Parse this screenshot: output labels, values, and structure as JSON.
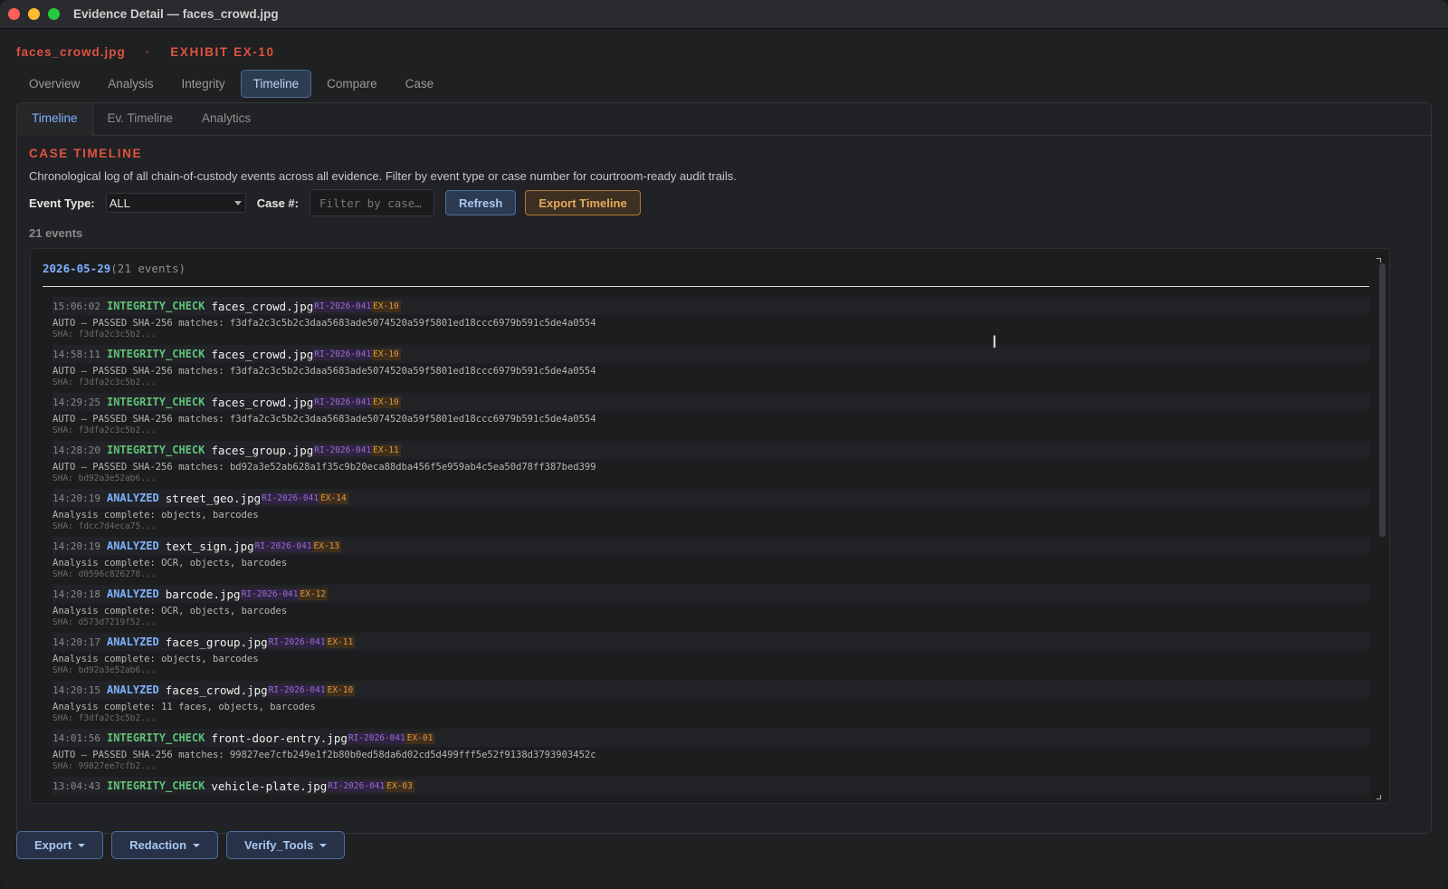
{
  "window": {
    "title": "Evidence Detail — faces_crowd.jpg"
  },
  "header": {
    "filename": "faces_crowd.jpg",
    "separator": "·",
    "exhibit": "EXHIBIT EX-10"
  },
  "tabs": [
    "Overview",
    "Analysis",
    "Integrity",
    "Timeline",
    "Compare",
    "Case"
  ],
  "active_tab": "Timeline",
  "subtabs": [
    "Timeline",
    "Ev. Timeline",
    "Analytics"
  ],
  "active_subtab": "Timeline",
  "timeline": {
    "title": "CASE TIMELINE",
    "description": "Chronological log of all chain-of-custody events across all evidence. Filter by event type or case number for courtroom-ready audit trails.",
    "event_type_label": "Event Type:",
    "event_type_value": "ALL",
    "case_label": "Case #:",
    "case_placeholder": "Filter by case…",
    "refresh_label": "Refresh",
    "export_label": "Export Timeline",
    "event_count": "21 events"
  },
  "log": {
    "date": "2026-05-29",
    "date_count": "(21 events)",
    "entries": [
      {
        "time": "15:06:02",
        "type": "INTEGRITY_CHECK",
        "kind": "integrity",
        "file": "faces_crowd.jpg",
        "case": "RI-2026-041",
        "exhibit": "EX-10",
        "detail": "AUTO — PASSED SHA-256 matches: f3dfa2c3c5b2c3daa5683ade5074520a59f5801ed18ccc6979b591c5de4a0554",
        "sha": "SHA: f3dfa2c3c5b2..."
      },
      {
        "time": "14:58:11",
        "type": "INTEGRITY_CHECK",
        "kind": "integrity",
        "file": "faces_crowd.jpg",
        "case": "RI-2026-041",
        "exhibit": "EX-10",
        "detail": "AUTO — PASSED SHA-256 matches: f3dfa2c3c5b2c3daa5683ade5074520a59f5801ed18ccc6979b591c5de4a0554",
        "sha": "SHA: f3dfa2c3c5b2..."
      },
      {
        "time": "14:29:25",
        "type": "INTEGRITY_CHECK",
        "kind": "integrity",
        "file": "faces_crowd.jpg",
        "case": "RI-2026-041",
        "exhibit": "EX-10",
        "detail": "AUTO — PASSED SHA-256 matches: f3dfa2c3c5b2c3daa5683ade5074520a59f5801ed18ccc6979b591c5de4a0554",
        "sha": "SHA: f3dfa2c3c5b2..."
      },
      {
        "time": "14:28:20",
        "type": "INTEGRITY_CHECK",
        "kind": "integrity",
        "file": "faces_group.jpg",
        "case": "RI-2026-041",
        "exhibit": "EX-11",
        "detail": "AUTO — PASSED SHA-256 matches: bd92a3e52ab628a1f35c9b20eca88dba456f5e959ab4c5ea50d78ff387bed399",
        "sha": "SHA: bd92a3e52ab6..."
      },
      {
        "time": "14:20:19",
        "type": "ANALYZED",
        "kind": "analyzed",
        "file": "street_geo.jpg",
        "case": "RI-2026-041",
        "exhibit": "EX-14",
        "detail": "Analysis complete: objects, barcodes",
        "sha": "SHA: fdcc7d4eca75..."
      },
      {
        "time": "14:20:19",
        "type": "ANALYZED",
        "kind": "analyzed",
        "file": "text_sign.jpg",
        "case": "RI-2026-041",
        "exhibit": "EX-13",
        "detail": "Analysis complete: OCR, objects, barcodes",
        "sha": "SHA: d0596c826278..."
      },
      {
        "time": "14:20:18",
        "type": "ANALYZED",
        "kind": "analyzed",
        "file": "barcode.jpg",
        "case": "RI-2026-041",
        "exhibit": "EX-12",
        "detail": "Analysis complete: OCR, objects, barcodes",
        "sha": "SHA: d573d7219f52..."
      },
      {
        "time": "14:20:17",
        "type": "ANALYZED",
        "kind": "analyzed",
        "file": "faces_group.jpg",
        "case": "RI-2026-041",
        "exhibit": "EX-11",
        "detail": "Analysis complete: objects, barcodes",
        "sha": "SHA: bd92a3e52ab6..."
      },
      {
        "time": "14:20:15",
        "type": "ANALYZED",
        "kind": "analyzed",
        "file": "faces_crowd.jpg",
        "case": "RI-2026-041",
        "exhibit": "EX-10",
        "detail": "Analysis complete: 11 faces, objects, barcodes",
        "sha": "SHA: f3dfa2c3c5b2..."
      },
      {
        "time": "14:01:56",
        "type": "INTEGRITY_CHECK",
        "kind": "integrity",
        "file": "front-door-entry.jpg",
        "case": "RI-2026-041",
        "exhibit": "EX-01",
        "detail": "AUTO — PASSED SHA-256 matches: 99827ee7cfb249e1f2b80b0ed58da6d02cd5d499fff5e52f9138d3793903452c",
        "sha": "SHA: 99827ee7cfb2..."
      },
      {
        "time": "13:04:43",
        "type": "INTEGRITY_CHECK",
        "kind": "integrity",
        "file": "vehicle-plate.jpg",
        "case": "RI-2026-041",
        "exhibit": "EX-03",
        "detail": "",
        "sha": ""
      }
    ]
  },
  "bottom": {
    "export": "Export",
    "redaction": "Redaction",
    "verify": "Verify_Tools"
  },
  "icons": {
    "cursor": "text-cursor-icon"
  }
}
